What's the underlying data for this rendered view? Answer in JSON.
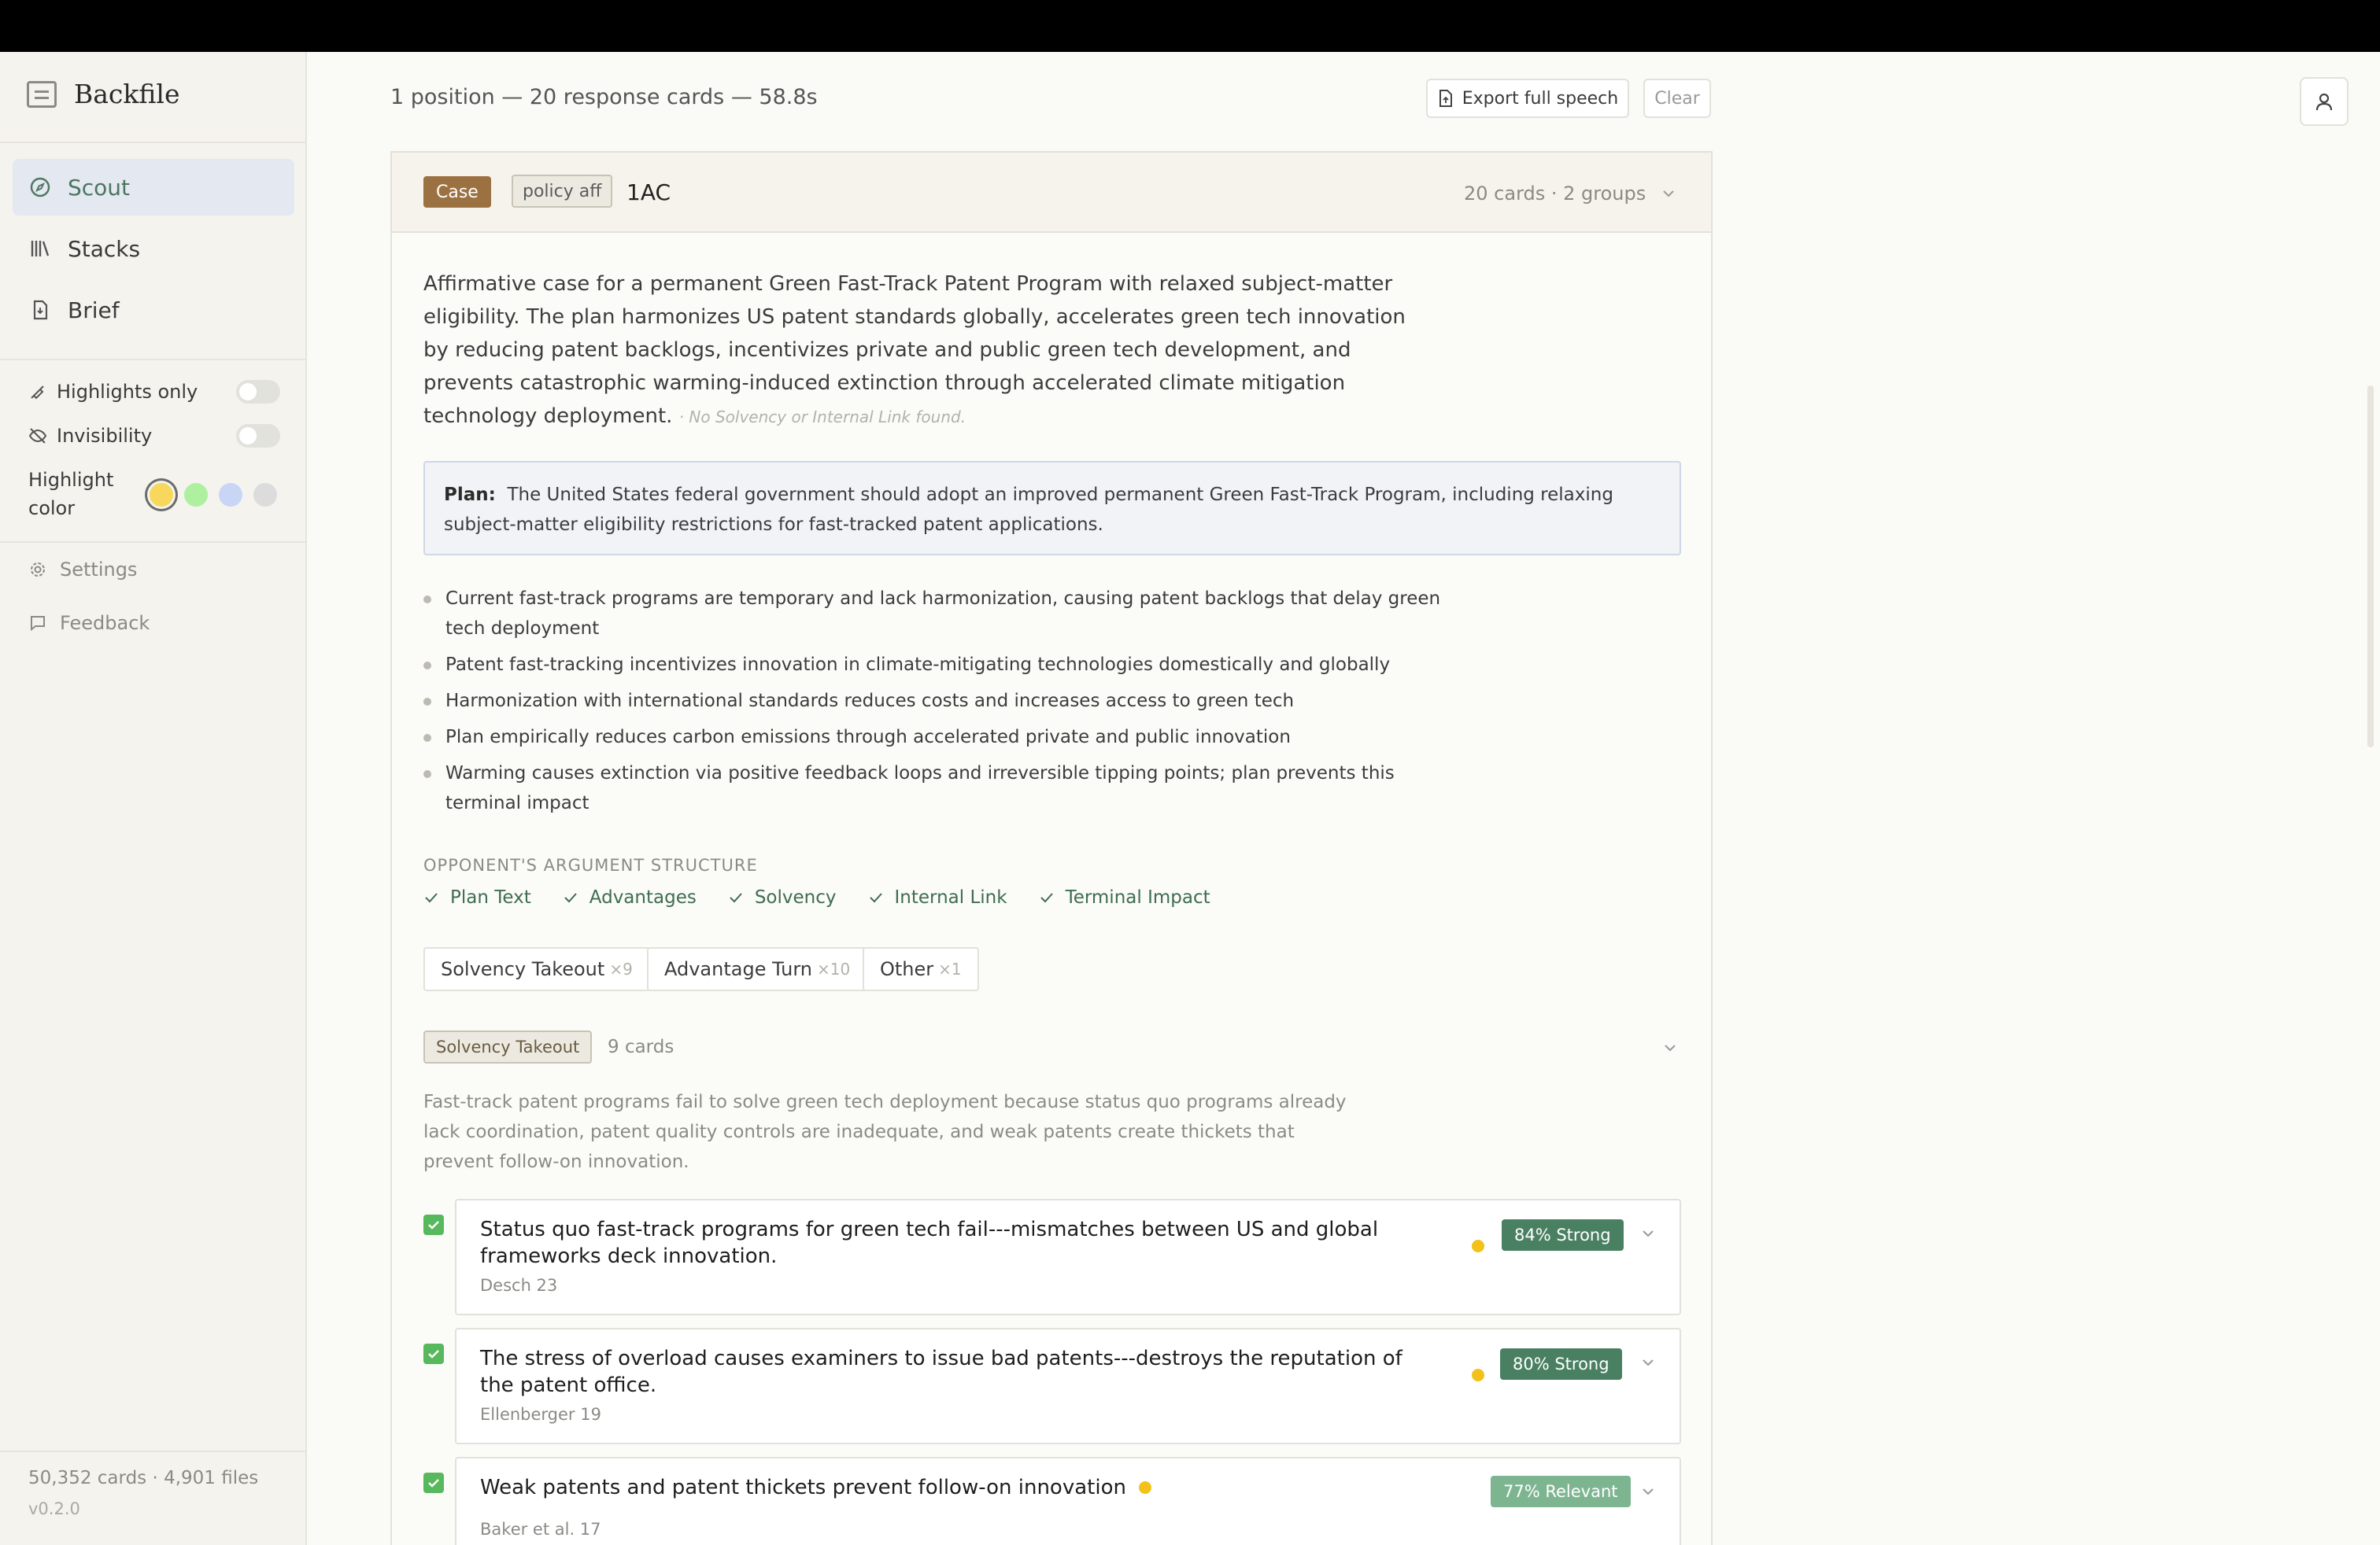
{
  "app": {
    "name": "Backfile",
    "version": "v0.2.0"
  },
  "sidebar": {
    "nav": [
      {
        "label": "Scout",
        "icon": "compass-icon",
        "active": true
      },
      {
        "label": "Stacks",
        "icon": "library-icon",
        "active": false
      },
      {
        "label": "Brief",
        "icon": "file-icon",
        "active": false
      }
    ],
    "toggles": {
      "highlights_only": {
        "label": "Highlights only",
        "on": false
      },
      "invisibility": {
        "label": "Invisibility",
        "on": false
      }
    },
    "highlight_color": {
      "label": "Highlight color",
      "options": [
        "#f7d85c",
        "#aef0a0",
        "#c9d5f5",
        "#dcdcdc"
      ],
      "selected": "#f7d85c"
    },
    "settings_label": "Settings",
    "feedback_label": "Feedback",
    "stats": "50,352 cards · 4,901 files"
  },
  "main": {
    "summary": "1 position — 20 response cards — 58.8s",
    "export_label": "Export full speech",
    "clear_label": "Clear",
    "case": {
      "badge": "Case",
      "type": "policy aff",
      "title": "1AC",
      "meta": "20 cards · 2 groups",
      "description": "Affirmative case for a permanent Green Fast-Track Patent Program with relaxed subject-matter eligibility. The plan harmonizes US patent standards globally, accelerates green tech innovation by reducing patent backlogs, incentivizes private and public green tech development, and prevents catastrophic warming-induced extinction through accelerated climate mitigation technology deployment.",
      "description_note": "· No Solvency or Internal Link found.",
      "plan_label": "Plan:",
      "plan_text": "The United States federal government should adopt an improved permanent Green Fast-Track Program, including relaxing subject-matter eligibility restrictions for fast-tracked patent applications.",
      "bullets": [
        "Current fast-track programs are temporary and lack harmonization, causing patent backlogs that delay green tech deployment",
        "Patent fast-tracking incentivizes innovation in climate-mitigating technologies domestically and globally",
        "Harmonization with international standards reduces costs and increases access to green tech",
        "Plan empirically reduces carbon emissions through accelerated private and public innovation",
        "Warming causes extinction via positive feedback loops and irreversible tipping points; plan prevents this terminal impact"
      ],
      "structure_label": "OPPONENT'S ARGUMENT STRUCTURE",
      "structure": [
        "Plan Text",
        "Advantages",
        "Solvency",
        "Internal Link",
        "Terminal Impact"
      ],
      "chips": [
        {
          "label": "Solvency Takeout",
          "count": "×9"
        },
        {
          "label": "Advantage Turn",
          "count": "×10"
        },
        {
          "label": "Other",
          "count": "×1"
        }
      ],
      "group": {
        "label": "Solvency Takeout",
        "count": "9 cards",
        "description": "Fast-track patent programs fail to solve green tech deployment because status quo programs already lack coordination, patent quality controls are inadequate, and weak patents create thickets that prevent follow-on innovation."
      },
      "responses": [
        {
          "title": "Status quo fast-track programs for green tech fail---mismatches between US and global frameworks deck innovation.",
          "author": "Desch 23",
          "score": "84% Strong",
          "checked": true
        },
        {
          "title": "The stress of overload causes examiners to issue bad patents---destroys the reputation of the patent office.",
          "author": "Ellenberger 19",
          "score": "80% Strong",
          "checked": true
        },
        {
          "title": "Weak patents and patent thickets prevent follow-on innovation",
          "author": "Baker et al. 17",
          "score": "77% Relevant",
          "checked": true
        }
      ]
    }
  }
}
